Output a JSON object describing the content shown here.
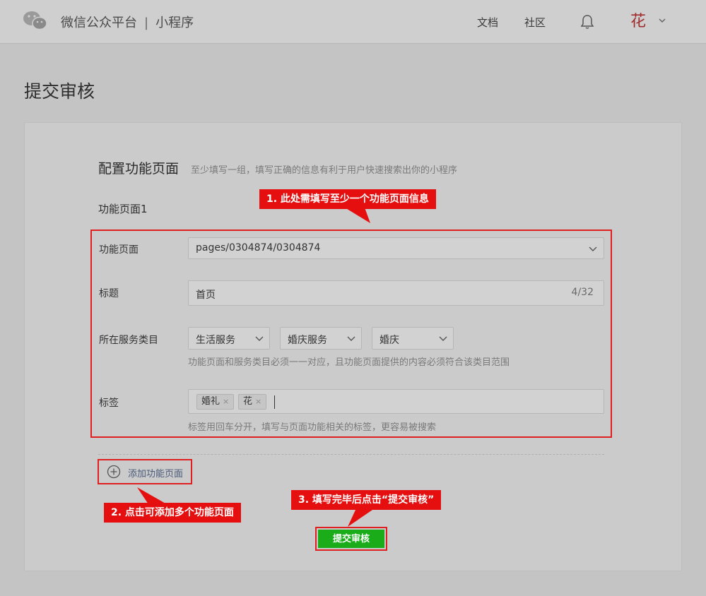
{
  "header": {
    "brand": "微信公众平台",
    "separator": "|",
    "product": "小程序",
    "nav_docs": "文档",
    "nav_community": "社区",
    "avatar_char": "花",
    "icons": [
      "wechat-logo-icon",
      "bell-icon",
      "chevron-down-icon"
    ]
  },
  "page": {
    "title": "提交审核"
  },
  "section": {
    "title": "配置功能页面",
    "hint": "至少填写一组，填写正确的信息有利于用户快速搜索出你的小程序",
    "group_label": "功能页面1"
  },
  "form": {
    "page_label": "功能页面",
    "page_value": "pages/0304874/0304874",
    "title_label": "标题",
    "title_value": "首页",
    "title_count": "4/32",
    "category_label": "所在服务类目",
    "categories": [
      "生活服务",
      "婚庆服务",
      "婚庆"
    ],
    "category_hint": "功能页面和服务类目必须一一对应，且功能页面提供的内容必须符合该类目范围",
    "tags_label": "标签",
    "tags": [
      "婚礼",
      "花"
    ],
    "tag_remove": "×",
    "tags_hint": "标签用回车分开，填写与页面功能相关的标签，更容易被搜索"
  },
  "actions": {
    "add_page": "添加功能页面",
    "submit": "提交审核"
  },
  "annotations": {
    "callout_1": "1. 此处需填写至少一个功能页面信息",
    "callout_2": "2. 点击可添加多个功能页面",
    "callout_3": "3. 填写完毕后点击“提交审核”"
  },
  "colors": {
    "accent_green": "#1aad19",
    "annotation_red": "#e60f0f"
  }
}
